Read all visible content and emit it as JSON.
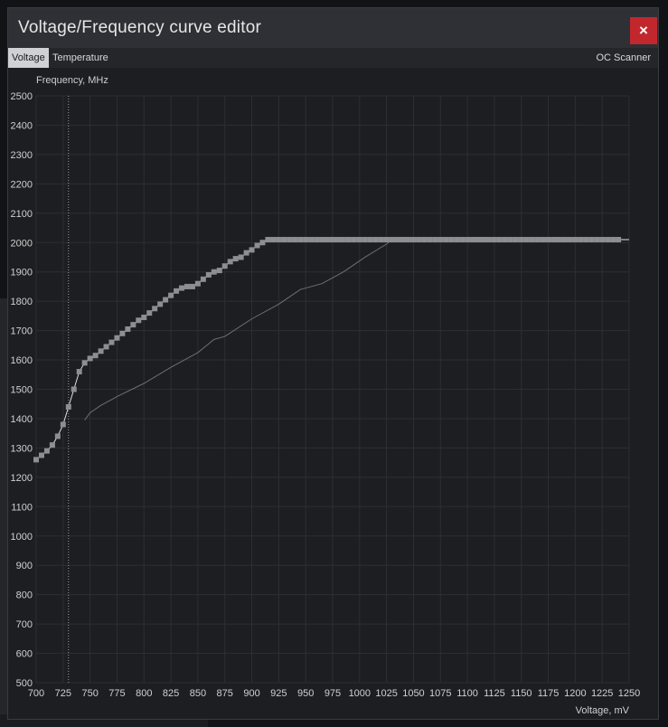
{
  "window": {
    "title": "Voltage/Frequency curve editor",
    "close_label": "×"
  },
  "tabs": [
    {
      "label": "Voltage",
      "active": true
    },
    {
      "label": "Temperature",
      "active": false
    }
  ],
  "oc_scanner_label": "OC Scanner",
  "colors": {
    "background": "#1d1e22",
    "grid": "#2d2e33",
    "curve_points": "#8e8e92",
    "curve_line": "#e0e0e0",
    "baseline_curve": "#6e6e73",
    "close_button": "#c2272d"
  },
  "chart_data": {
    "type": "line",
    "xlabel": "Voltage, mV",
    "ylabel": "Frequency, MHz",
    "xlim": [
      700,
      1250
    ],
    "ylim": [
      500,
      2500
    ],
    "x_ticks": [
      700,
      725,
      750,
      775,
      800,
      825,
      850,
      875,
      900,
      925,
      950,
      975,
      1000,
      1025,
      1050,
      1075,
      1100,
      1125,
      1150,
      1175,
      1200,
      1225,
      1250
    ],
    "y_ticks": [
      500,
      600,
      700,
      800,
      900,
      1000,
      1100,
      1200,
      1300,
      1400,
      1500,
      1600,
      1700,
      1800,
      1900,
      2000,
      2100,
      2200,
      2300,
      2400,
      2500
    ],
    "grid": true,
    "marker_voltage": 730,
    "series": [
      {
        "points": [
          [
            700,
            1260
          ],
          [
            705,
            1275
          ],
          [
            710,
            1290
          ],
          [
            715,
            1310
          ],
          [
            720,
            1340
          ],
          [
            725,
            1380
          ],
          [
            730,
            1440
          ],
          [
            735,
            1500
          ],
          [
            740,
            1560
          ],
          [
            745,
            1590
          ],
          [
            750,
            1605
          ],
          [
            755,
            1615
          ],
          [
            760,
            1630
          ],
          [
            765,
            1645
          ],
          [
            770,
            1660
          ],
          [
            775,
            1675
          ],
          [
            780,
            1690
          ],
          [
            785,
            1705
          ],
          [
            790,
            1720
          ],
          [
            795,
            1735
          ],
          [
            800,
            1745
          ],
          [
            805,
            1760
          ],
          [
            810,
            1775
          ],
          [
            815,
            1790
          ],
          [
            820,
            1805
          ],
          [
            825,
            1820
          ],
          [
            830,
            1835
          ],
          [
            835,
            1845
          ],
          [
            840,
            1850
          ],
          [
            845,
            1850
          ],
          [
            850,
            1860
          ],
          [
            855,
            1875
          ],
          [
            860,
            1890
          ],
          [
            865,
            1900
          ],
          [
            870,
            1905
          ],
          [
            875,
            1920
          ],
          [
            880,
            1935
          ],
          [
            885,
            1945
          ],
          [
            890,
            1950
          ],
          [
            895,
            1965
          ],
          [
            900,
            1975
          ],
          [
            905,
            1990
          ],
          [
            910,
            2000
          ],
          [
            915,
            2010
          ],
          [
            920,
            2010
          ],
          [
            925,
            2010
          ],
          [
            930,
            2010
          ],
          [
            935,
            2010
          ],
          [
            940,
            2010
          ],
          [
            945,
            2010
          ],
          [
            950,
            2010
          ],
          [
            955,
            2010
          ],
          [
            960,
            2010
          ],
          [
            965,
            2010
          ],
          [
            970,
            2010
          ],
          [
            975,
            2010
          ],
          [
            980,
            2010
          ],
          [
            985,
            2010
          ],
          [
            990,
            2010
          ],
          [
            995,
            2010
          ],
          [
            1000,
            2010
          ],
          [
            1005,
            2010
          ],
          [
            1010,
            2010
          ],
          [
            1015,
            2010
          ],
          [
            1020,
            2010
          ],
          [
            1025,
            2010
          ],
          [
            1030,
            2010
          ],
          [
            1035,
            2010
          ],
          [
            1040,
            2010
          ],
          [
            1045,
            2010
          ],
          [
            1050,
            2010
          ],
          [
            1055,
            2010
          ],
          [
            1060,
            2010
          ],
          [
            1065,
            2010
          ],
          [
            1070,
            2010
          ],
          [
            1075,
            2010
          ],
          [
            1080,
            2010
          ],
          [
            1085,
            2010
          ],
          [
            1090,
            2010
          ],
          [
            1095,
            2010
          ],
          [
            1100,
            2010
          ],
          [
            1105,
            2010
          ],
          [
            1110,
            2010
          ],
          [
            1115,
            2010
          ],
          [
            1120,
            2010
          ],
          [
            1125,
            2010
          ],
          [
            1130,
            2010
          ],
          [
            1135,
            2010
          ],
          [
            1140,
            2010
          ],
          [
            1145,
            2010
          ],
          [
            1150,
            2010
          ],
          [
            1155,
            2010
          ],
          [
            1160,
            2010
          ],
          [
            1165,
            2010
          ],
          [
            1170,
            2010
          ],
          [
            1175,
            2010
          ],
          [
            1180,
            2010
          ],
          [
            1185,
            2010
          ],
          [
            1190,
            2010
          ],
          [
            1195,
            2010
          ],
          [
            1200,
            2010
          ],
          [
            1205,
            2010
          ],
          [
            1210,
            2010
          ],
          [
            1215,
            2010
          ],
          [
            1220,
            2010
          ],
          [
            1225,
            2010
          ],
          [
            1230,
            2010
          ],
          [
            1235,
            2010
          ],
          [
            1240,
            2010
          ]
        ]
      },
      {
        "points": [
          [
            745,
            1395
          ],
          [
            750,
            1420
          ],
          [
            760,
            1445
          ],
          [
            775,
            1475
          ],
          [
            800,
            1520
          ],
          [
            825,
            1575
          ],
          [
            850,
            1625
          ],
          [
            865,
            1670
          ],
          [
            875,
            1680
          ],
          [
            900,
            1740
          ],
          [
            925,
            1790
          ],
          [
            935,
            1815
          ],
          [
            945,
            1840
          ],
          [
            955,
            1850
          ],
          [
            965,
            1860
          ],
          [
            985,
            1900
          ],
          [
            1005,
            1950
          ],
          [
            1025,
            1995
          ],
          [
            1030,
            2010
          ],
          [
            1250,
            2010
          ]
        ]
      }
    ]
  }
}
